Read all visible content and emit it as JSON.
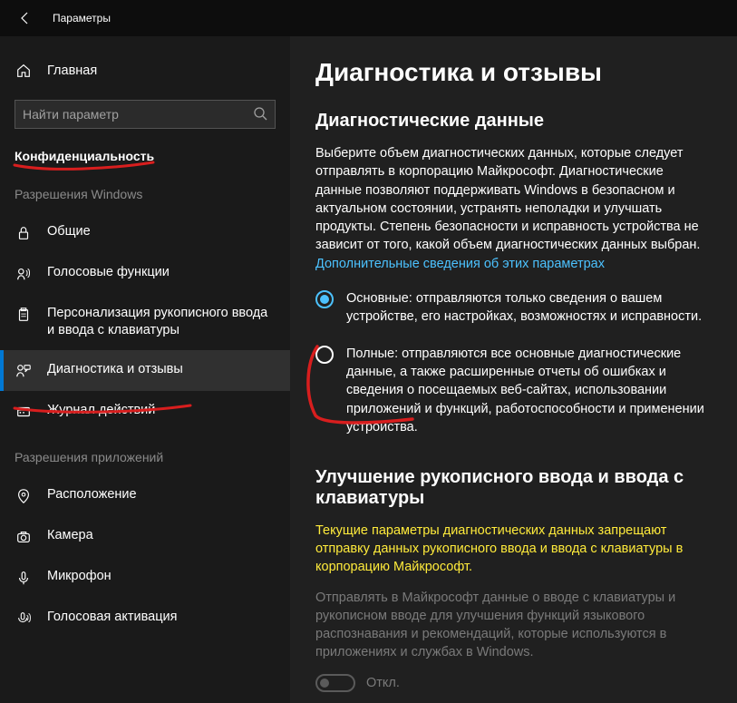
{
  "window": {
    "title": "Параметры"
  },
  "sidebar": {
    "home": "Главная",
    "search_placeholder": "Найти параметр",
    "heading": "Конфиденциальность",
    "group1_label": "Разрешения Windows",
    "group1": [
      {
        "label": "Общие"
      },
      {
        "label": "Голосовые функции"
      },
      {
        "label": "Персонализация рукописного ввода и ввода с клавиатуры"
      },
      {
        "label": "Диагностика и отзывы"
      },
      {
        "label": "Журнал действий"
      }
    ],
    "group2_label": "Разрешения приложений",
    "group2": [
      {
        "label": "Расположение"
      },
      {
        "label": "Камера"
      },
      {
        "label": "Микрофон"
      },
      {
        "label": "Голосовая активация"
      }
    ]
  },
  "content": {
    "title": "Диагностика и отзывы",
    "diag_data": {
      "heading": "Диагностические данные",
      "intro": "Выберите объем диагностических данных, которые следует отправлять в корпорацию Майкрософт. Диагностические данные позволяют поддерживать Windows в безопасном и актуальном состоянии, устранять неполадки и улучшать продукты. Степень безопасности и исправность устройства не зависит от того, какой объем диагностических данных выбран. ",
      "link": "Дополнительные сведения об этих параметрах",
      "option_basic": "Основные: отправляются только сведения о вашем устройстве, его настройках, возможностях и исправности.",
      "option_full": "Полные: отправляются все основные диагностические данные, а также расширенные отчеты об ошибках и сведения о посещаемых веб-сайтах, использовании приложений и функций, работоспособности и применении устройства.",
      "selected": "basic"
    },
    "typing": {
      "heading": "Улучшение рукописного ввода и ввода с клавиатуры",
      "warning": "Текущие параметры диагностических данных запрещают отправку данных рукописного ввода и ввода с клавиатуры в корпорацию Майкрософт.",
      "disabled_desc": "Отправлять в Майкрософт данные о вводе с клавиатуры и рукописном вводе для улучшения функций языкового распознавания и рекомендаций, которые используются в приложениях и службах в Windows.",
      "toggle_state": "Откл."
    }
  }
}
